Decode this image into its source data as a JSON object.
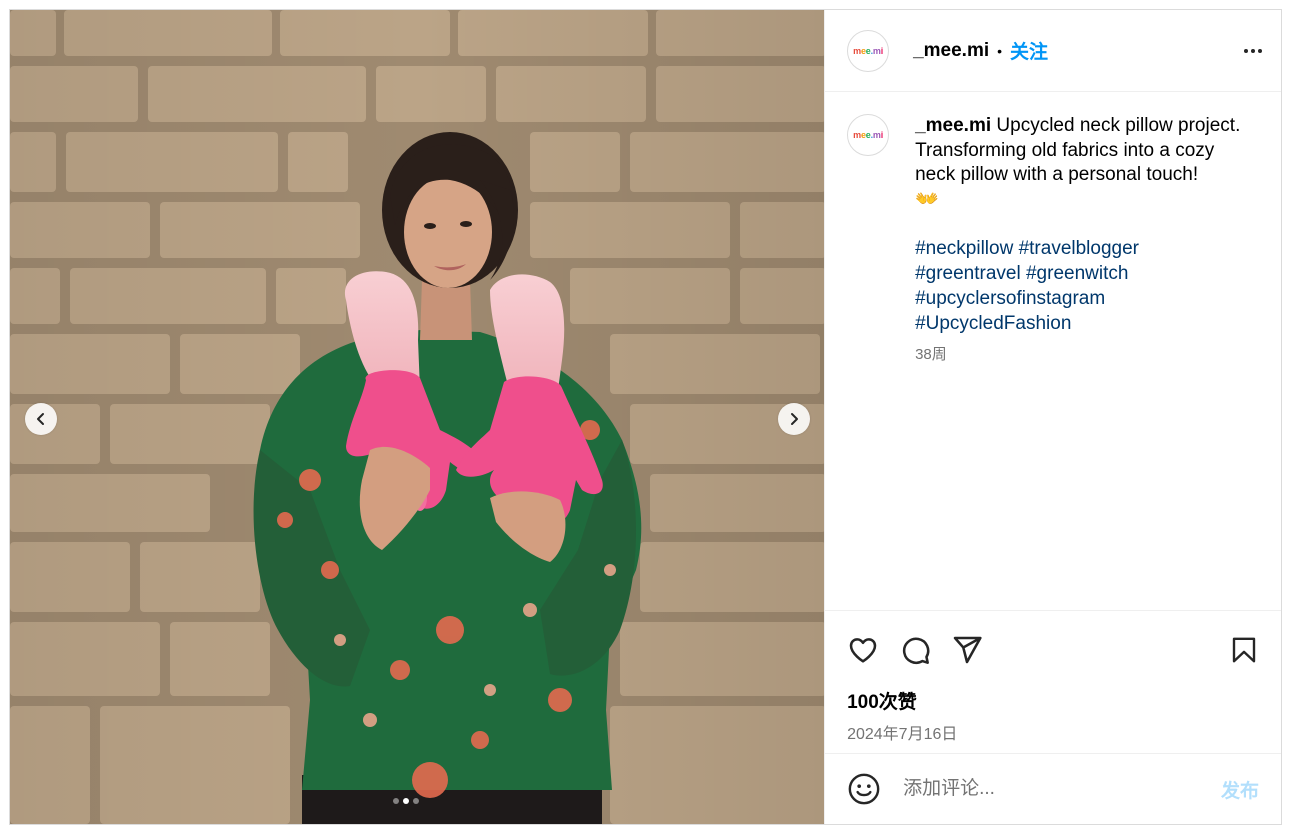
{
  "post": {
    "author": {
      "username": "_mee.mi",
      "avatar_text": [
        "m",
        "e",
        "e",
        ".",
        "m",
        "i"
      ]
    },
    "separator": "•",
    "follow_label": "关注",
    "more_icon": "more-horizontal-icon",
    "caption": {
      "username": "_mee.mi",
      "line1": "Upcycled neck pillow project.",
      "line2": "Transforming old fabrics into a cozy neck pillow with a personal touch!",
      "emoji": "👐",
      "hashtags": [
        "#neckpillow #travelblogger",
        "#greentravel #greenwitch",
        "#upcyclersofinstagram",
        "#UpcycledFashion"
      ],
      "time_ago": "38周"
    },
    "media": {
      "prev_icon": "chevron-left-icon",
      "next_icon": "chevron-right-icon",
      "dot_count": 3,
      "active_dot": 1
    },
    "actions": {
      "like_icon": "heart-icon",
      "comment_icon": "comment-icon",
      "share_icon": "send-icon",
      "save_icon": "bookmark-icon"
    },
    "likes": "100次赞",
    "date": "2024年7月16日",
    "comment": {
      "placeholder": "添加评论...",
      "value": "",
      "post_label": "发布",
      "emoji_icon": "smiley-icon"
    }
  },
  "colors": {
    "accent": "#0095f6",
    "hashtag": "#00376b",
    "muted": "#737373",
    "post_disabled": "#b2dffc"
  }
}
